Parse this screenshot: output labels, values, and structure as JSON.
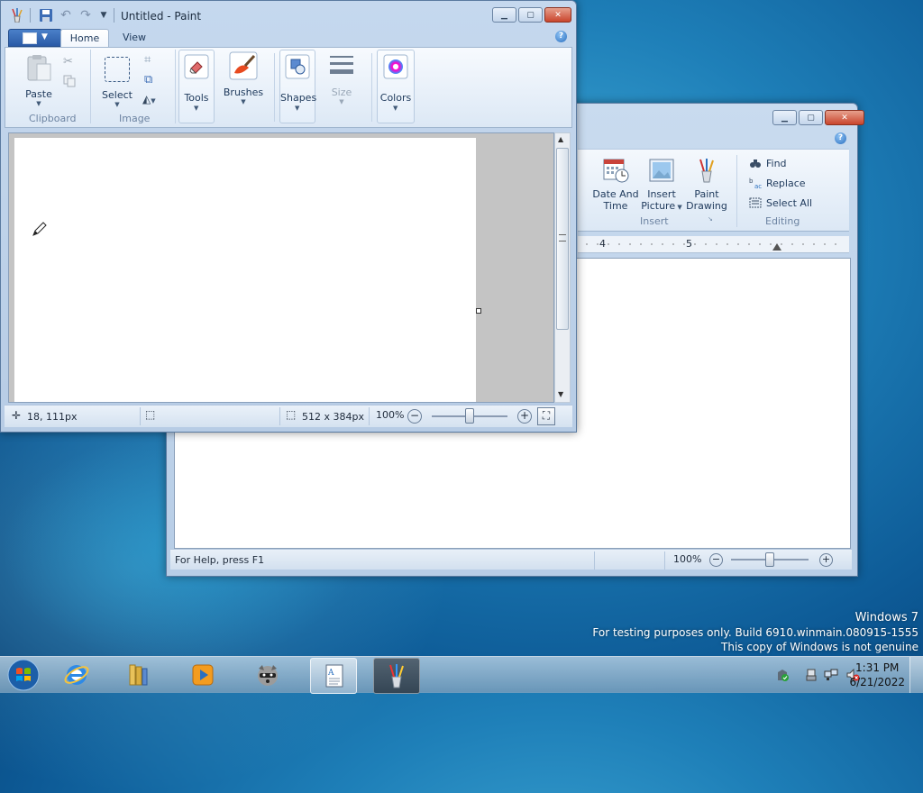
{
  "wordpad": {
    "ribbon": {
      "date_time_line1": "Date And",
      "date_time_line2": "Time",
      "insert_picture_line1": "Insert",
      "insert_picture_line2": "Picture",
      "paint_drawing_line1": "Paint",
      "paint_drawing_line2": "Drawing",
      "insert_group": "Insert",
      "find": "Find",
      "replace": "Replace",
      "select_all": "Select All",
      "editing_group": "Editing"
    },
    "ruler": {
      "mark4": "4",
      "mark5": "5"
    },
    "status": {
      "help_text": "For Help, press F1",
      "zoom": "100%"
    }
  },
  "paint": {
    "title": "Untitled - Paint",
    "tabs": {
      "home": "Home",
      "view": "View"
    },
    "ribbon": {
      "paste": "Paste",
      "clipboard_group": "Clipboard",
      "select": "Select",
      "image_group": "Image",
      "tools": "Tools",
      "brushes": "Brushes",
      "shapes": "Shapes",
      "size": "Size",
      "colors": "Colors"
    },
    "status": {
      "cursor_pos": "18, 111px",
      "canvas_size": "512 x 384px",
      "zoom": "100%"
    }
  },
  "watermark": {
    "line1": "Windows 7",
    "line2": "For testing purposes only. Build 6910.winmain.080915-1555",
    "line3": "This copy of Windows is not genuine"
  },
  "taskbar": {
    "time": "1:31 PM",
    "date": "6/21/2022"
  }
}
